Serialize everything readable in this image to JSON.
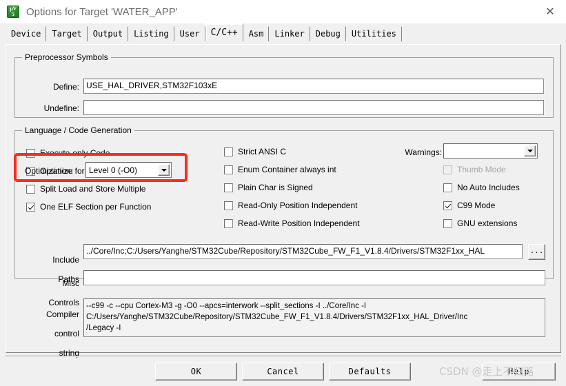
{
  "window": {
    "title": "Options for Target 'WATER_APP'",
    "icon": "uvision-icon",
    "close_label": "✕",
    "icon_top": "µV",
    "icon_bottom": "5"
  },
  "tabs": [
    {
      "label": "Device",
      "selected": false
    },
    {
      "label": "Target",
      "selected": false
    },
    {
      "label": "Output",
      "selected": false
    },
    {
      "label": "Listing",
      "selected": false
    },
    {
      "label": "User",
      "selected": false
    },
    {
      "label": "C/C++",
      "selected": true
    },
    {
      "label": "Asm",
      "selected": false
    },
    {
      "label": "Linker",
      "selected": false
    },
    {
      "label": "Debug",
      "selected": false
    },
    {
      "label": "Utilities",
      "selected": false
    }
  ],
  "preprocessor": {
    "legend": "Preprocessor Symbols",
    "define_label": "Define:",
    "define_value": "USE_HAL_DRIVER,STM32F103xE",
    "undefine_label": "Undefine:",
    "undefine_value": ""
  },
  "language": {
    "legend": "Language / Code Generation",
    "optimization_label": "Optimization:",
    "optimization_value": "Level 0 (-O0)",
    "warnings_label": "Warnings:",
    "warnings_value": "",
    "col1": [
      {
        "label": "Execute-only Code",
        "checked": false,
        "disabled": false
      },
      {
        "label": "Optimize for Time",
        "checked": false,
        "disabled": false
      },
      {
        "label": "Split Load and Store Multiple",
        "checked": false,
        "disabled": false
      },
      {
        "label": "One ELF Section per Function",
        "checked": true,
        "disabled": false
      }
    ],
    "col2": [
      {
        "label": "Strict ANSI C",
        "checked": false,
        "disabled": false
      },
      {
        "label": "Enum Container always int",
        "checked": false,
        "disabled": false
      },
      {
        "label": "Plain Char is Signed",
        "checked": false,
        "disabled": false
      },
      {
        "label": "Read-Only Position Independent",
        "checked": false,
        "disabled": false
      },
      {
        "label": "Read-Write Position Independent",
        "checked": false,
        "disabled": false
      }
    ],
    "col3": [
      {
        "label": "Thumb Mode",
        "checked": false,
        "disabled": true
      },
      {
        "label": "No Auto Includes",
        "checked": false,
        "disabled": false
      },
      {
        "label": "C99 Mode",
        "checked": true,
        "disabled": false
      },
      {
        "label": "GNU extensions",
        "checked": false,
        "disabled": false
      }
    ]
  },
  "paths": {
    "include_label_l1": "Include",
    "include_label_l2": "Paths",
    "include_value": "../Core/Inc;C:/Users/Yanghe/STM32Cube/Repository/STM32Cube_FW_F1_V1.8.4/Drivers/STM32F1xx_HAL",
    "browse_label": "...",
    "misc_label_l1": "Misc",
    "misc_label_l2": "Controls",
    "misc_value": "",
    "compiler_label_l1": "Compiler",
    "compiler_label_l2": "control",
    "compiler_label_l3": "string",
    "compiler_value": "--c99 -c --cpu Cortex-M3 -g -O0 --apcs=interwork --split_sections -I ../Core/Inc -I\nC:/Users/Yanghe/STM32Cube/Repository/STM32Cube_FW_F1_V1.8.4/Drivers/STM32F1xx_HAL_Driver/Inc\n/Legacy -I"
  },
  "footer": {
    "ok": "OK",
    "cancel": "Cancel",
    "defaults": "Defaults",
    "help": "Help"
  },
  "annotation": {
    "highlight_color": "#fb2c1b"
  },
  "watermark": {
    "text": "CSDN @走上不归路"
  }
}
